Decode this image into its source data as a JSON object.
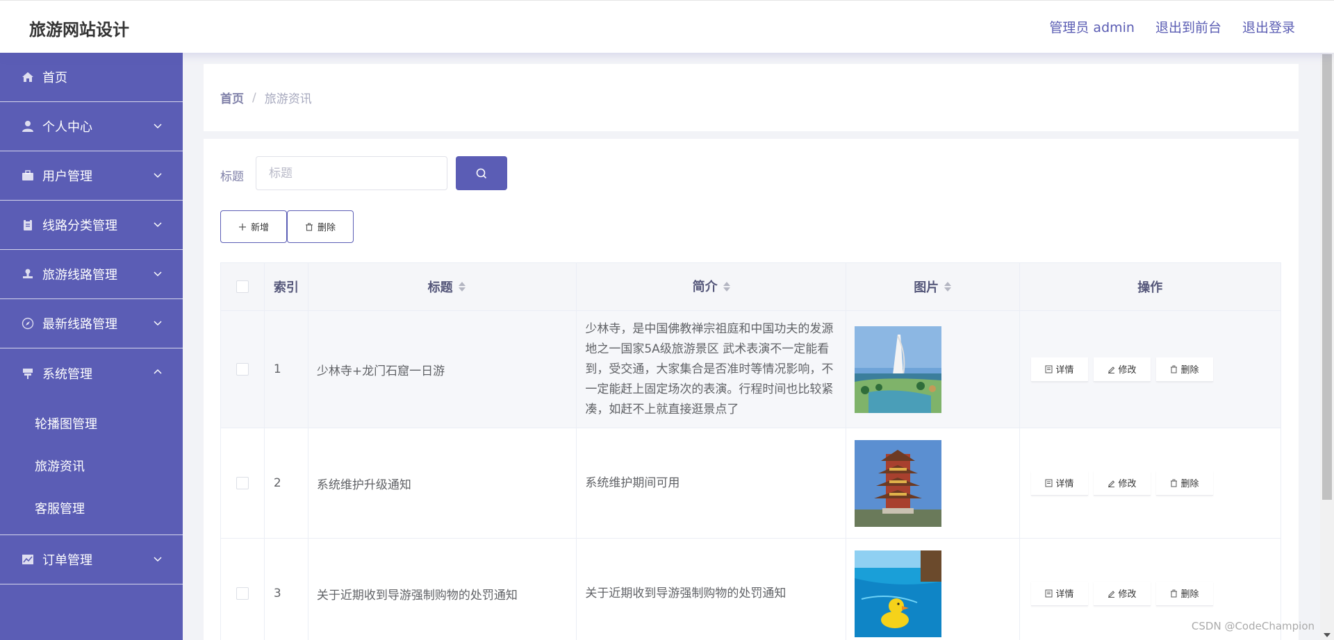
{
  "header": {
    "app_title": "旅游网站设计",
    "links": [
      "管理员 admin",
      "退出到前台",
      "退出登录"
    ]
  },
  "sidebar": {
    "items": [
      {
        "label": "首页",
        "icon": "home-icon"
      },
      {
        "label": "个人中心",
        "icon": "user-icon"
      },
      {
        "label": "用户管理",
        "icon": "briefcase-icon"
      },
      {
        "label": "线路分类管理",
        "icon": "clipboard-icon"
      },
      {
        "label": "旅游线路管理",
        "icon": "stamp-icon"
      },
      {
        "label": "最新线路管理",
        "icon": "compass-icon"
      },
      {
        "label": "系统管理",
        "icon": "signpost-icon"
      },
      {
        "label": "订单管理",
        "icon": "chart-icon"
      }
    ],
    "system_sub": [
      "轮播图管理",
      "旅游资讯",
      "客服管理"
    ]
  },
  "breadcrumb": {
    "home": "首页",
    "separator": "/",
    "current": "旅游资讯"
  },
  "search": {
    "label": "标题",
    "placeholder": "标题"
  },
  "actions": {
    "add": "新增",
    "delete": "删除"
  },
  "table": {
    "headers": {
      "index": "索引",
      "title": "标题",
      "desc": "简介",
      "image": "图片",
      "ops": "操作"
    },
    "ops": {
      "detail": "详情",
      "edit": "修改",
      "delete": "删除"
    },
    "rows": [
      {
        "index": "1",
        "title": "少林寺+龙门石窟一日游",
        "desc": "少林寺，是中国佛教禅宗祖庭和中国功夫的发源地之一国家5A级旅游景区 武术表演不一定能看到，受交通，大家集合是否准时等情况影响，不一定能赶上固定场次的表演。行程时间也比较紧凑，如赶不上就直接逛景点了",
        "image": "burj-al-arab-resort"
      },
      {
        "index": "2",
        "title": "系统维护升级通知",
        "desc": "系统维护期间可用",
        "image": "yellow-crane-tower"
      },
      {
        "index": "3",
        "title": "关于近期收到导游强制购物的处罚通知",
        "desc": "关于近期收到导游强制购物的处罚通知",
        "image": "rubber-duck-pool"
      }
    ]
  },
  "watermark": "CSDN @CodeChampion",
  "colors": {
    "primary": "#5b5db5",
    "header_text": "#5a5cb3"
  }
}
